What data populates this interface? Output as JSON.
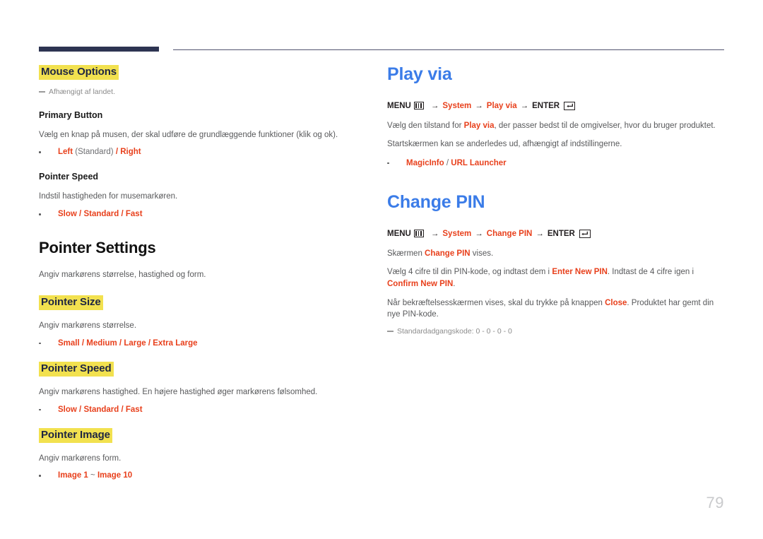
{
  "page": {
    "number": "79"
  },
  "left_column": {
    "section_mouse_options": {
      "heading": "Mouse Options",
      "note": "Afhængigt af landet.",
      "primary_button": {
        "heading": "Primary Button",
        "description": "Vælg en knap på musen, der skal udføre de grundlæggende funktioner (klik og ok).",
        "option_1": "Left",
        "option_1_suffix": "(Standard)",
        "separator": " / ",
        "option_2": "Right"
      },
      "pointer_speed": {
        "heading": "Pointer Speed",
        "description": "Indstil hastigheden for musemarkøren.",
        "option_1": "Slow",
        "option_2": "Standard",
        "option_3": "Fast"
      }
    },
    "section_pointer_settings": {
      "heading": "Pointer Settings",
      "description": "Angiv markørens størrelse, hastighed og form.",
      "pointer_size": {
        "heading": "Pointer Size",
        "description": "Angiv markørens størrelse.",
        "option_1": "Small",
        "option_2": "Medium",
        "option_3": "Large",
        "option_4": "Extra Large"
      },
      "pointer_speed": {
        "heading": "Pointer Speed",
        "description": "Angiv markørens hastighed. En højere hastighed øger markørens følsomhed.",
        "option_1": "Slow",
        "option_2": "Standard",
        "option_3": "Fast"
      },
      "pointer_image": {
        "heading": "Pointer Image",
        "description": "Angiv markørens form.",
        "option_1": "Image 1",
        "option_range_sep": " ~ ",
        "option_2": "Image 10"
      }
    }
  },
  "right_column": {
    "section_play_via": {
      "heading": "Play via",
      "menu_path": {
        "menu_label": "MENU",
        "menu_icon": "menu-grid-icon",
        "arrow": "→",
        "step_1": "System",
        "step_2": "Play via",
        "enter_label": "ENTER",
        "enter_icon": "enter-key-icon"
      },
      "paragraph_1_pre": "Vælg den tilstand for ",
      "paragraph_1_bold": "Play via",
      "paragraph_1_post": ", der passer bedst til de omgivelser, hvor du bruger produktet.",
      "paragraph_2": "Startskærmen kan se anderledes ud, afhængigt af indstillingerne.",
      "option_1": "MagicInfo",
      "option_sep": " / ",
      "option_2": "URL Launcher"
    },
    "section_change_pin": {
      "heading": "Change PIN",
      "menu_path": {
        "menu_label": "MENU",
        "menu_icon": "menu-grid-icon",
        "arrow": "→",
        "step_1": "System",
        "step_2": "Change PIN",
        "enter_label": "ENTER",
        "enter_icon": "enter-key-icon"
      },
      "paragraph_1_pre": "Skærmen ",
      "paragraph_1_bold": "Change PIN",
      "paragraph_1_post": " vises.",
      "paragraph_2_pre": "Vælg 4 cifre til din PIN-kode, og indtast dem i ",
      "paragraph_2_bold_1": "Enter New PIN",
      "paragraph_2_mid": ". Indtast de 4 cifre igen i ",
      "paragraph_2_bold_2": "Confirm New PIN",
      "paragraph_2_post": ".",
      "paragraph_3_pre": "Når bekræftelsesskærmen vises, skal du trykke på knappen ",
      "paragraph_3_bold": "Close",
      "paragraph_3_post": ". Produktet har gemt din nye PIN-kode.",
      "note": "Standardadgangskode: 0 - 0 - 0 - 0"
    }
  },
  "colors": {
    "accent_blue": "#3b7ce8",
    "accent_red": "#e8401c",
    "highlight_yellow": "#f2e14f",
    "rule_navy": "#2d3452",
    "body_gray": "#58595b",
    "page_number_gray": "#c9cacc"
  }
}
